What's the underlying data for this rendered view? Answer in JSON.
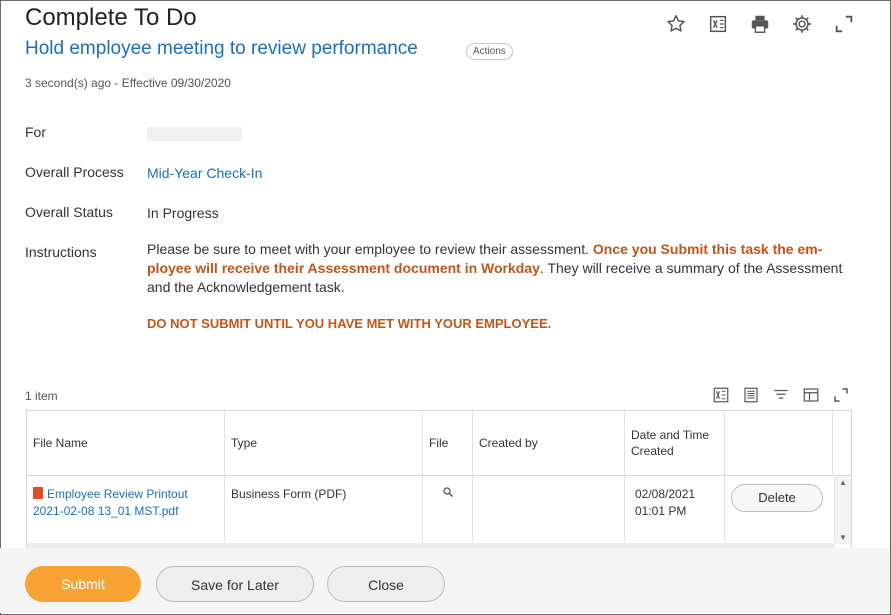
{
  "header": {
    "title": "Complete To Do",
    "task_title": "Hold employee meeting to review performance",
    "actions_label": "Actions",
    "meta": "3 second(s) ago -  Effective 09/30/2020"
  },
  "top_icons": [
    "star-icon",
    "excel-export-icon",
    "print-icon",
    "gear-icon",
    "expand-icon"
  ],
  "fields": {
    "for_label": "For",
    "for_value": "",
    "process_label": "Overall Process",
    "process_value": "Mid-Year Check-In",
    "status_label": "Overall Status",
    "status_value": "In Progress",
    "instructions_label": "Instructions",
    "instructions_part1": "Please be sure to meet with your employee to review their assessment. ",
    "instructions_bold": "Once you Submit this task the em-ployee will receive their Assessment document in Workday",
    "instructions_part2": ". They will receive a summary of the Assessment and the Acknowledgement task.",
    "warning": "DO NOT SUBMIT UNTIL YOU HAVE MET WITH YOUR EMPLOYEE."
  },
  "attachments": {
    "count": "1 item",
    "tool_icons": [
      "excel-export-icon",
      "pdf-icon",
      "filter-icon",
      "columns-icon",
      "fullscreen-icon"
    ],
    "columns": [
      "File Name",
      "Type",
      "File",
      "Created by",
      "Date and Time Created"
    ],
    "rows": [
      {
        "file_name": "Employee Review Printout 2021-02-08 13_01 MST.pdf",
        "type": "Business Form (PDF)",
        "file_icon": "magnifier-icon",
        "created_by": "",
        "date_time": "02/08/2021 01:01 PM",
        "action": "Delete"
      }
    ]
  },
  "footer": {
    "submit": "Submit",
    "save_later": "Save for Later",
    "close": "Close"
  },
  "colors": {
    "link": "#1d6fb8",
    "warning": "#c2561a",
    "primary_button": "#f6a235"
  }
}
